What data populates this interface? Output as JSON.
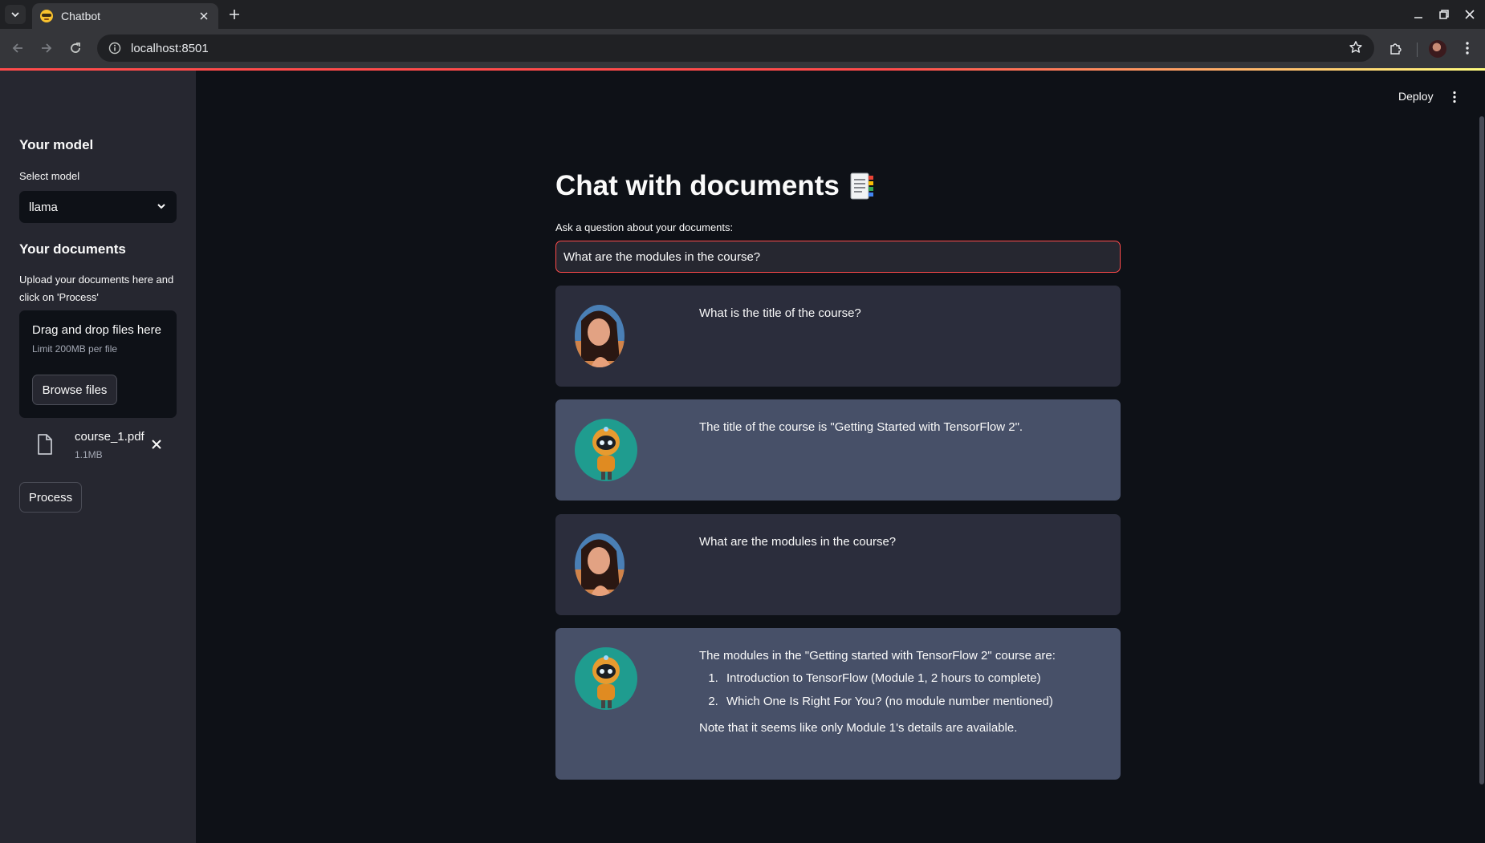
{
  "browser": {
    "tab_title": "Chatbot",
    "url": "localhost:8501"
  },
  "sidebar": {
    "model_heading": "Your model",
    "select_label": "Select model",
    "selected_model": "llama",
    "documents_heading": "Your documents",
    "upload_description": "Upload your documents here and click on 'Process'",
    "dropzone": {
      "title": "Drag and drop files here",
      "limit": "Limit 200MB per file",
      "browse_label": "Browse files"
    },
    "file": {
      "name": "course_1.pdf",
      "size": "1.1MB"
    },
    "process_label": "Process"
  },
  "header": {
    "deploy_label": "Deploy"
  },
  "main": {
    "title": "Chat with documents",
    "input_label": "Ask a question about your documents:",
    "input_value": "What are the modules in the course?"
  },
  "messages": [
    {
      "role": "user",
      "text": "What is the title of the course?"
    },
    {
      "role": "bot",
      "text": "The title of the course is \"Getting Started with TensorFlow 2\"."
    },
    {
      "role": "user",
      "text": "What are the modules in the course?"
    },
    {
      "role": "bot",
      "intro": "The modules in the \"Getting started with TensorFlow 2\" course are:",
      "items": [
        "Introduction to TensorFlow (Module 1, 2 hours to complete)",
        "Which One Is Right For You? (no module number mentioned)"
      ],
      "note": "Note that it seems like only Module 1's details are available."
    }
  ],
  "colors": {
    "accent": "#ff4b4b",
    "background": "#0e1117",
    "sidebar": "#262730",
    "user_bubble": "#2b2d3c",
    "bot_bubble": "#475068"
  },
  "icons": {
    "tab_favicon": "sunglasses-emoji-icon",
    "title_emoji": "bookmark-tabs-emoji-icon",
    "user_avatar": "user-avatar",
    "bot_avatar": "robot-avatar"
  }
}
